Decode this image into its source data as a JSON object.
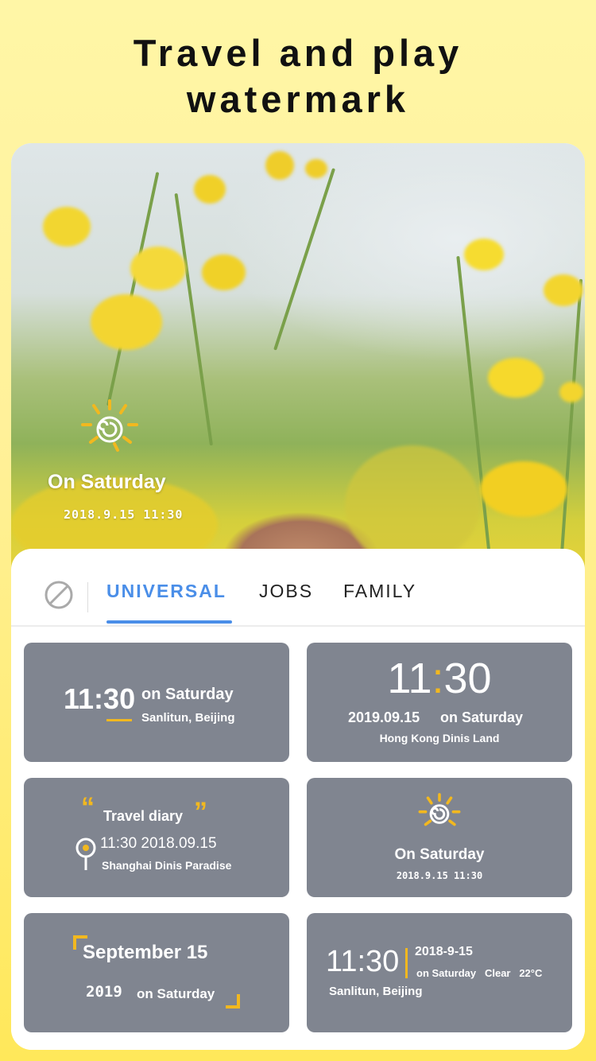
{
  "headline": {
    "line1": "Travel and play",
    "line2": "watermark"
  },
  "preview": {
    "watermark_title": "On Saturday",
    "watermark_datetime": "2018.9.15  11:30"
  },
  "tabs": {
    "items": [
      {
        "label": "UNIVERSAL",
        "active": true
      },
      {
        "label": "JOBS",
        "active": false
      },
      {
        "label": "FAMILY",
        "active": false
      }
    ]
  },
  "templates": [
    {
      "time": "11:30",
      "day": "on Saturday",
      "place": "Sanlitun, Beijing"
    },
    {
      "time_h": "11",
      "time_sep": ":",
      "time_m": "30",
      "date": "2019.09.15",
      "day": "on Saturday",
      "place": "Hong Kong Dinis Land"
    },
    {
      "quote_open": "“",
      "title": "Travel diary",
      "quote_close": "”",
      "time_date": "11:30  2018.09.15",
      "place": "Shanghai Dinis Paradise"
    },
    {
      "title": "On Saturday",
      "datetime": "2018.9.15  11:30"
    },
    {
      "title": "September 15",
      "year": "2019",
      "day": "on Saturday"
    },
    {
      "time": "11:30",
      "date": "2018-9-15",
      "details": "on Saturday   Clear   22°C",
      "place": "Sanlitun, Beijing"
    }
  ],
  "colors": {
    "accent": "#4a8ee8",
    "tile": "#808590",
    "highlight": "#f2b81f"
  }
}
